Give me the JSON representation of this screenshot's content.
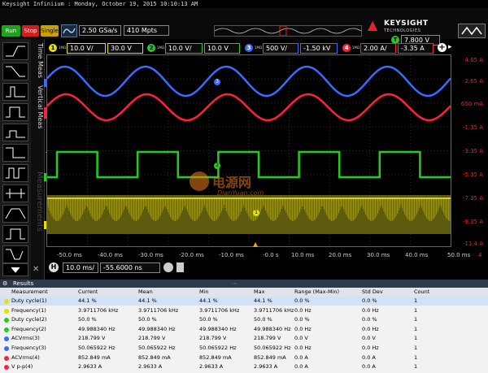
{
  "window": {
    "title": "Keysight Infiniium : Monday, October 19, 2015 10:10:13 AM"
  },
  "brand": {
    "logo_text": "KEYSIGHT",
    "tagline": "TECHNOLOGIES"
  },
  "toolbar": {
    "run_label": "Run",
    "stop_label": "Stop",
    "single_label": "Single",
    "sample_rate": "2.50 GSa/s",
    "memory_depth": "410 Mpts",
    "trigger_channel": "T",
    "trigger_level": "7.800 V"
  },
  "channels": [
    {
      "number": "1",
      "impedance": "1MΩ",
      "scale": "10.0 V/",
      "offset": "30.0 V",
      "color": "#e8e000"
    },
    {
      "number": "2",
      "impedance": "1MΩ",
      "scale": "10.0 V/",
      "offset": "10.0 V",
      "color": "#22cc22"
    },
    {
      "number": "3",
      "impedance": "1MΩ",
      "scale": "500 V/",
      "offset": "-1.50 kV",
      "color": "#3a6bff"
    },
    {
      "number": "4",
      "impedance": "1MΩ",
      "scale": "2.00 A/",
      "offset": "-3.35 A",
      "color": "#ff2040"
    }
  ],
  "side_tabs": {
    "time_meas": "Time Meas",
    "vertical_meas": "Vertical Meas",
    "measurements": "Measurements"
  },
  "y_axis_labels": [
    "4.65 A",
    "2.65 A",
    "650 mA",
    "-1.35 A",
    "-3.35 A",
    "-5.35 A",
    "-7.35 A",
    "-9.35 A",
    "-11.4 A"
  ],
  "x_axis_labels": [
    "-50.0 ms",
    "-40.0 ms",
    "-30.0 ms",
    "-20.0 ms",
    "-10.0 ms",
    "-0.0 s",
    "10.0 ms",
    "20.0 ms",
    "30.0 ms",
    "40.0 ms",
    "50.0 ms"
  ],
  "marker_labels": {
    "m1": "1",
    "m2": "2",
    "m3": "3",
    "m4": "4",
    "x_right": "4",
    "trig": "T"
  },
  "watermark": {
    "text": "电源网",
    "sub": "DianYuan.com"
  },
  "horizontal": {
    "badge": "H",
    "scale": "10.0 ms/",
    "position": "-55.6000 ns"
  },
  "results": {
    "title": "Results",
    "headers": {
      "measurement": "Measurement",
      "current": "Current",
      "mean": "Mean",
      "min": "Min",
      "max": "Max",
      "range": "Range (Max-Min)",
      "std_dev": "Std Dev",
      "count": "Count"
    },
    "rows": [
      {
        "name": "Duty cycle(1)",
        "current": "44.1 %",
        "mean": "44.1 %",
        "min": "44.1 %",
        "max": "44.1 %",
        "range": "0.0 %",
        "std_dev": "0.0 %",
        "count": "1",
        "color": "#e8e000"
      },
      {
        "name": "Frequency(1)",
        "current": "3.9711706 kHz",
        "mean": "3.9711706 kHz",
        "min": "3.9711706 kHz",
        "max": "3.9711706 kHz",
        "range": "0.0 Hz",
        "std_dev": "0.0 Hz",
        "count": "1",
        "color": "#e8e000"
      },
      {
        "name": "Duty cycle(2)",
        "current": "50.0 %",
        "mean": "50.0 %",
        "min": "50.0 %",
        "max": "50.0 %",
        "range": "0.0 %",
        "std_dev": "0.0 %",
        "count": "1",
        "color": "#22cc22"
      },
      {
        "name": "Frequency(2)",
        "current": "49.988340 Hz",
        "mean": "49.988340 Hz",
        "min": "49.988340 Hz",
        "max": "49.988340 Hz",
        "range": "0.0 Hz",
        "std_dev": "0.0 Hz",
        "count": "1",
        "color": "#22cc22"
      },
      {
        "name": "ACVrms(3)",
        "current": "218.799 V",
        "mean": "218.799 V",
        "min": "218.799 V",
        "max": "218.799 V",
        "range": "0.0 V",
        "std_dev": "0.0 V",
        "count": "1",
        "color": "#3a6bff"
      },
      {
        "name": "Frequency(3)",
        "current": "50.065922 Hz",
        "mean": "50.065922 Hz",
        "min": "50.065922 Hz",
        "max": "50.065922 Hz",
        "range": "0.0 Hz",
        "std_dev": "0.0 Hz",
        "count": "1",
        "color": "#3a6bff"
      },
      {
        "name": "ACVrms(4)",
        "current": "852.849 mA",
        "mean": "852.849 mA",
        "min": "852.849 mA",
        "max": "852.849 mA",
        "range": "0.0 A",
        "std_dev": "0.0 A",
        "count": "1",
        "color": "#ff2040"
      },
      {
        "name": "V p-p(4)",
        "current": "2.9633 A",
        "mean": "2.9633 A",
        "min": "2.9633 A",
        "max": "2.9633 A",
        "range": "0.0 A",
        "std_dev": "0.0 A",
        "count": "1",
        "color": "#ff2040"
      }
    ]
  }
}
